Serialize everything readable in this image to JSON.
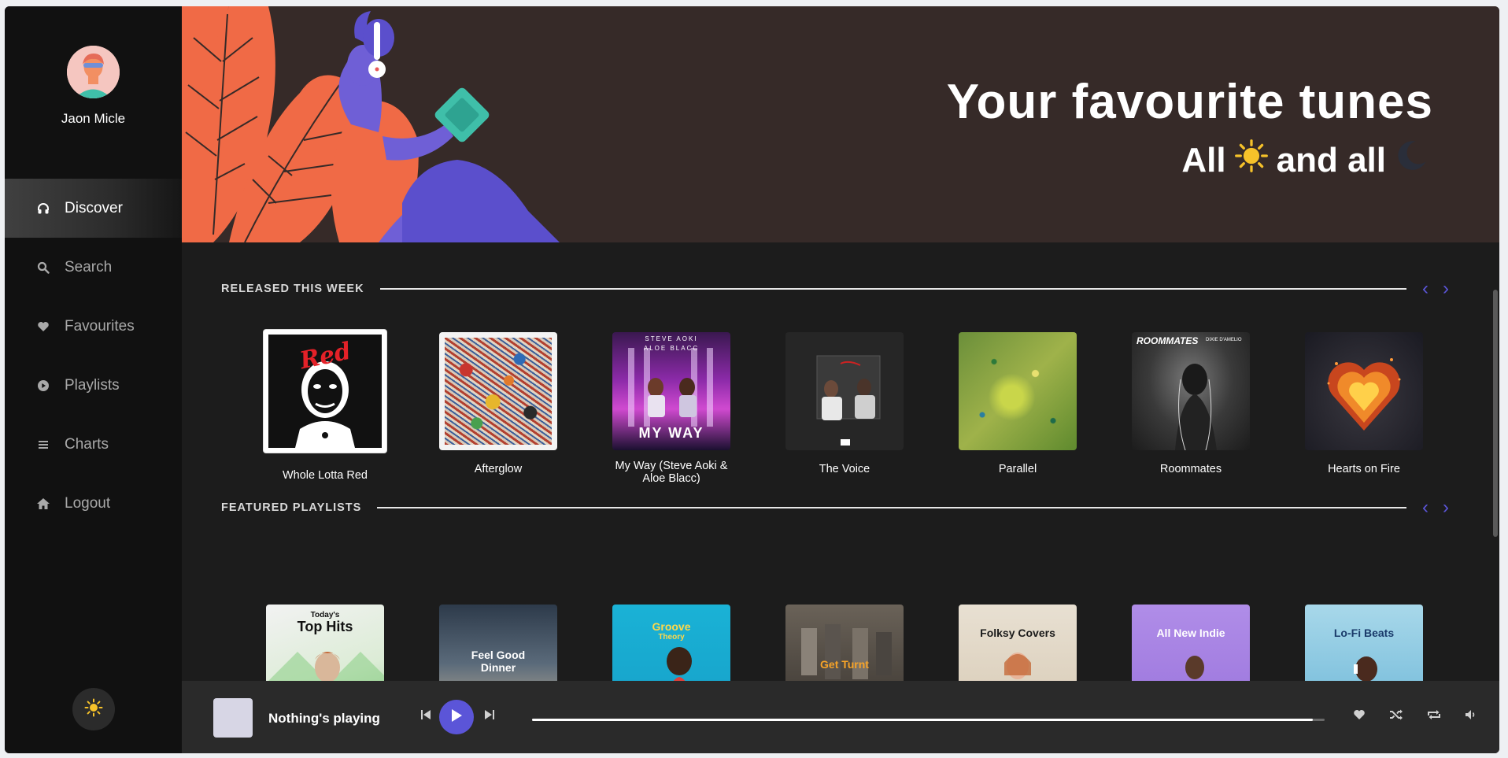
{
  "user": {
    "name": "Jaon Micle"
  },
  "nav": [
    {
      "label": "Discover",
      "icon": "headphones-icon",
      "active": true
    },
    {
      "label": "Search",
      "icon": "search-icon"
    },
    {
      "label": "Favourites",
      "icon": "heart-icon"
    },
    {
      "label": "Playlists",
      "icon": "play-circle-icon"
    },
    {
      "label": "Charts",
      "icon": "bars-icon"
    },
    {
      "label": "Logout",
      "icon": "home-icon"
    }
  ],
  "hero": {
    "title": "Your favourite tunes",
    "sub_part1": "All",
    "sub_part2": "and all",
    "bg_color": "#362a28"
  },
  "sections": {
    "released": {
      "title": "RELEASED THIS WEEK",
      "items": [
        {
          "label": "Whole Lotta Red"
        },
        {
          "label": "Afterglow"
        },
        {
          "label": "My Way (Steve Aoki & Aloe Blacc)"
        },
        {
          "label": "The Voice"
        },
        {
          "label": "Parallel"
        },
        {
          "label": "Roommates"
        },
        {
          "label": "Hearts on Fire"
        }
      ]
    },
    "featured": {
      "title": "FEATURED PLAYLISTS",
      "items": [
        {
          "cover_text_small": "Today's",
          "cover_text": "Top Hits"
        },
        {
          "cover_text": "Feel Good Dinner"
        },
        {
          "cover_text": "Groove",
          "cover_text_small": "Theory"
        },
        {
          "cover_text": "Get Turnt"
        },
        {
          "cover_text": "Folksy Covers"
        },
        {
          "cover_text": "All New Indie"
        },
        {
          "cover_text": "Lo-Fi Beats"
        }
      ]
    }
  },
  "album_art": {
    "whole_lotta_red": {
      "text": "Red"
    },
    "my_way": {
      "top_text": "STEVE AOKI",
      "mid_text": "ALOE BLACC",
      "text": "MY WAY"
    },
    "roommates": {
      "text": "ROOMMATES",
      "sub": "DIXIE D'AMELIO"
    }
  },
  "player": {
    "now_playing": "Nothing's playing",
    "progress": 0.985
  },
  "colors": {
    "accent": "#5b55d8",
    "sidebar": "#111111",
    "content": "#1c1c1c",
    "player": "#2a2a2a"
  }
}
